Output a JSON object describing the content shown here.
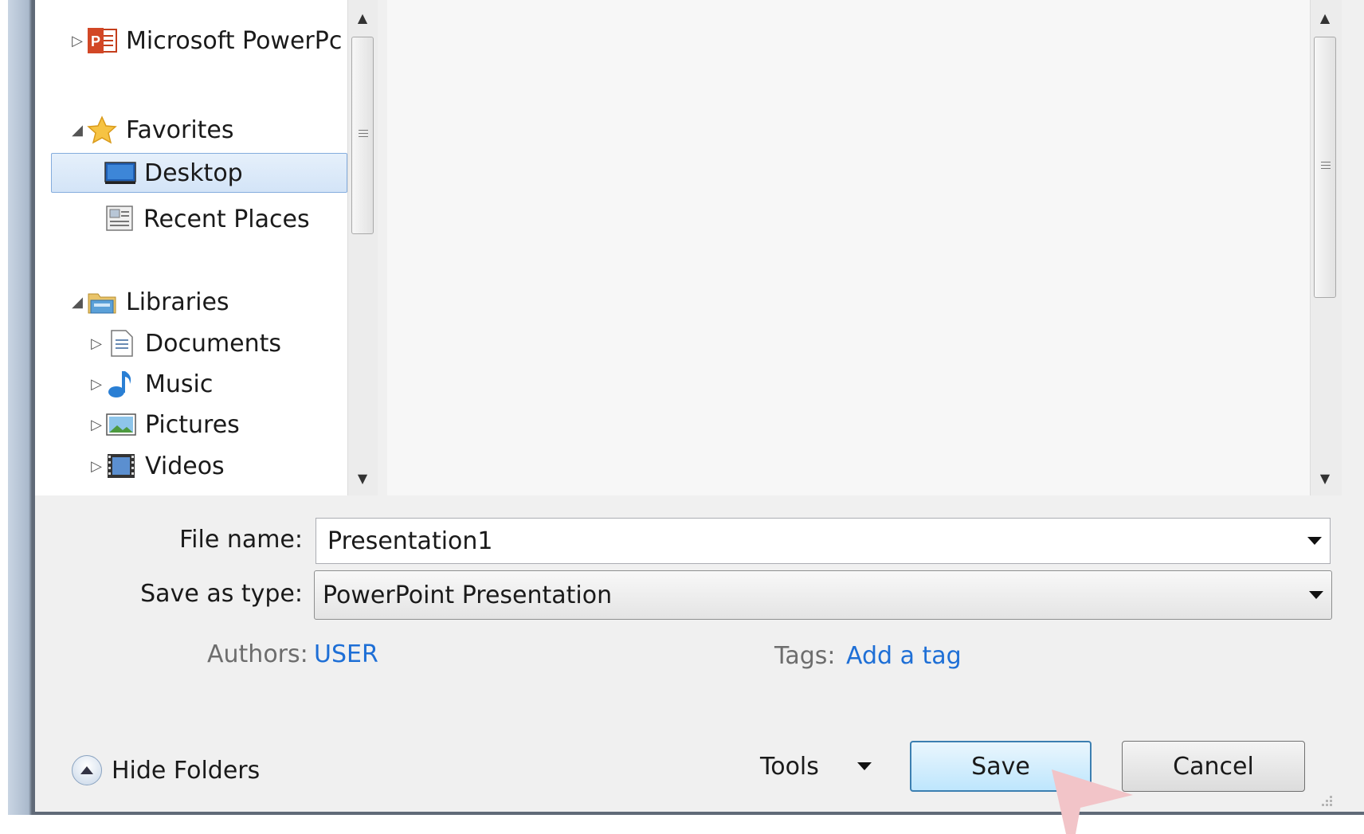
{
  "nav": {
    "items": [
      {
        "label": "Microsoft PowerPc",
        "icon": "powerpoint-icon",
        "expander": "▷"
      },
      {
        "label": "Favorites",
        "icon": "star-icon",
        "expander": "◢"
      },
      {
        "label": "Desktop",
        "icon": "desktop-icon",
        "expander": "",
        "selected": true
      },
      {
        "label": "Recent Places",
        "icon": "recent-places-icon",
        "expander": ""
      },
      {
        "label": "Libraries",
        "icon": "libraries-icon",
        "expander": "◢"
      },
      {
        "label": "Documents",
        "icon": "documents-icon",
        "expander": "▷"
      },
      {
        "label": "Music",
        "icon": "music-icon",
        "expander": "▷"
      },
      {
        "label": "Pictures",
        "icon": "pictures-icon",
        "expander": "▷"
      },
      {
        "label": "Videos",
        "icon": "videos-icon",
        "expander": "▷"
      }
    ]
  },
  "form": {
    "file_name_label": "File name:",
    "file_name_value": "Presentation1",
    "save_type_label": "Save as type:",
    "save_type_value": "PowerPoint Presentation"
  },
  "meta": {
    "authors_label": "Authors:",
    "authors_value": "USER",
    "tags_label": "Tags:",
    "tags_value": "Add a tag"
  },
  "footer": {
    "hide_folders_label": "Hide Folders",
    "tools_label": "Tools",
    "save_label": "Save",
    "cancel_label": "Cancel"
  },
  "colors": {
    "link": "#1e6fd6",
    "selection": "#d3e4f7",
    "save_button": "#bee6fd"
  }
}
